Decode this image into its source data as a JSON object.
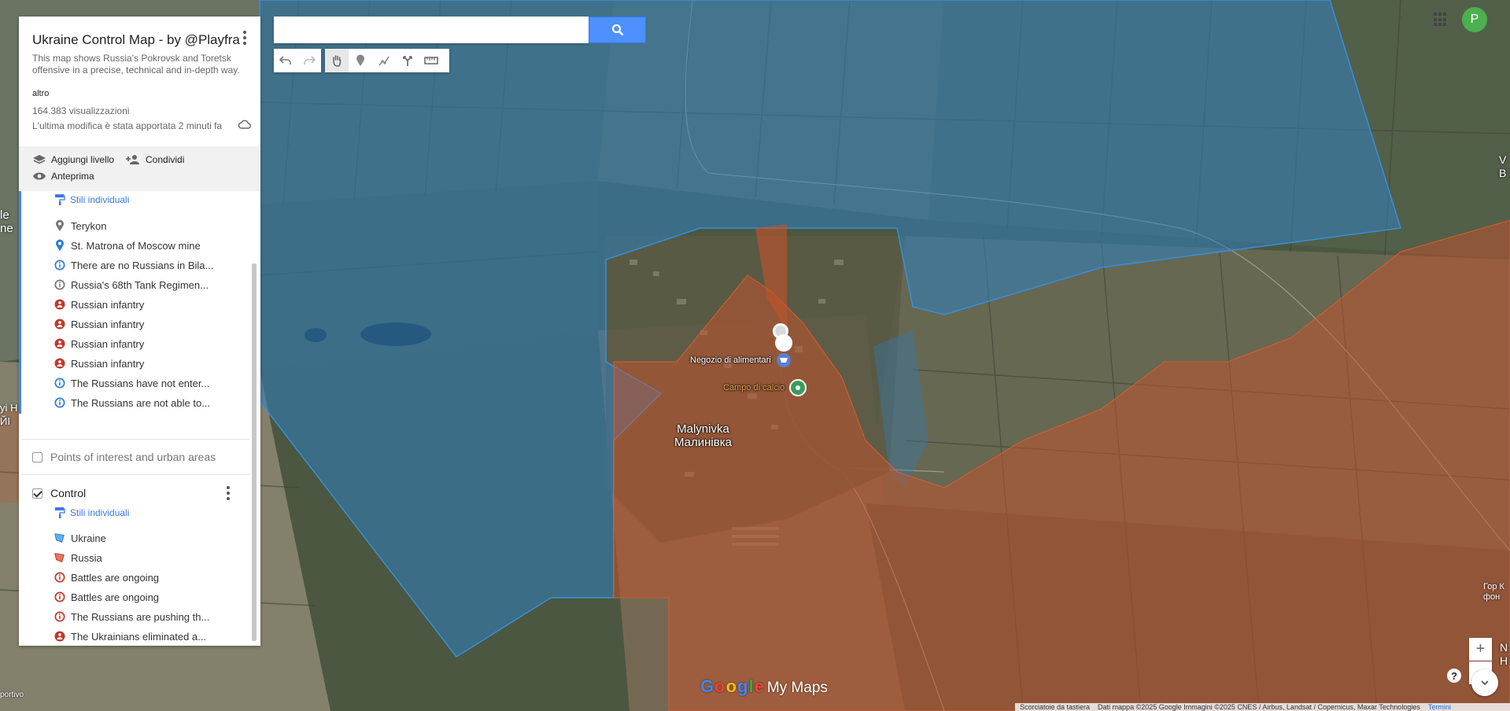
{
  "colors": {
    "ukraine_fill": "#2f7fbf",
    "russia_fill": "#c7512a",
    "accent_blue": "#4285f4",
    "link_blue": "#3b78e7",
    "avatar_green": "#4caf50",
    "marker_red": "#c0392b",
    "marker_blue": "#2a7fd4",
    "marker_grey": "#777777",
    "poi_green": "#3c9b5b"
  },
  "panel": {
    "title": "Ukraine Control Map - by @Playfra",
    "description": "This map shows Russia's Pokrovsk and Toretsk offensive in a precise, technical and in-depth way.",
    "more_link": "altro",
    "views": "164.383 visualizzazioni",
    "modified": "L'ultima modifica è stata apportata 2 minuti fa",
    "add_layer": "Aggiungi livello",
    "share": "Condividi",
    "preview": "Anteprima",
    "layer1": {
      "style_link": "Stili individuali",
      "features": [
        {
          "label": "Terykon",
          "icon": "grey-pin-icon"
        },
        {
          "label": "St. Matrona of Moscow mine",
          "icon": "blue-pin-icon"
        },
        {
          "label": "There are no Russians in Bila...",
          "icon": "info-blue-icon"
        },
        {
          "label": "Russia's 68th Tank Regimen...",
          "icon": "info-grey-icon"
        },
        {
          "label": "Russian infantry",
          "icon": "infantry-icon"
        },
        {
          "label": "Russian infantry",
          "icon": "infantry-icon"
        },
        {
          "label": "Russian infantry",
          "icon": "infantry-icon"
        },
        {
          "label": "Russian infantry",
          "icon": "infantry-icon"
        },
        {
          "label": "The Russians have not enter...",
          "icon": "info-blue-icon"
        },
        {
          "label": "The Russians are not able to...",
          "icon": "info-blue-icon"
        }
      ]
    },
    "layer2": {
      "name": "Points of interest and urban areas",
      "checked": false
    },
    "layer3": {
      "name": "Control",
      "checked": true,
      "style_link": "Stili individuali",
      "features": [
        {
          "label": "Ukraine",
          "icon": "polygon-blue-icon"
        },
        {
          "label": "Russia",
          "icon": "polygon-red-icon"
        },
        {
          "label": "Battles are ongoing",
          "icon": "info-red-icon"
        },
        {
          "label": "Battles are ongoing",
          "icon": "info-red-icon"
        },
        {
          "label": "The Russians are pushing th...",
          "icon": "info-red-icon"
        },
        {
          "label": "The Ukrainians eliminated a...",
          "icon": "infantry-icon"
        }
      ]
    }
  },
  "search": {
    "value": "",
    "placeholder": ""
  },
  "user": {
    "initial": "P"
  },
  "zoom": {
    "in": "+",
    "out": "−"
  },
  "help": "?",
  "map": {
    "town_latin": "Malynivka",
    "town_cyrillic": "Малинівка",
    "poi_shop": "Negozio di alimentari",
    "poi_football": "Campo di calcio",
    "edge_left": [
      "le",
      "ne"
    ],
    "edge_left2": [
      "yi H",
      "ЙІ"
    ],
    "edge_right": [
      "V",
      "B"
    ],
    "edge_right2": [
      "Гор К",
      "фон"
    ],
    "edge_right3": [
      "N",
      "Н"
    ],
    "left_bottom": "portivo"
  },
  "branding": {
    "my_maps": "My Maps"
  },
  "footer": {
    "shortcuts": "Scorciatoie da tastiera",
    "attribution": "Dati mappa ©2025 Google Immagini ©2025 CNES / Airbus, Landsat / Copernicus, Maxar Technologies",
    "terms": "Termini"
  }
}
